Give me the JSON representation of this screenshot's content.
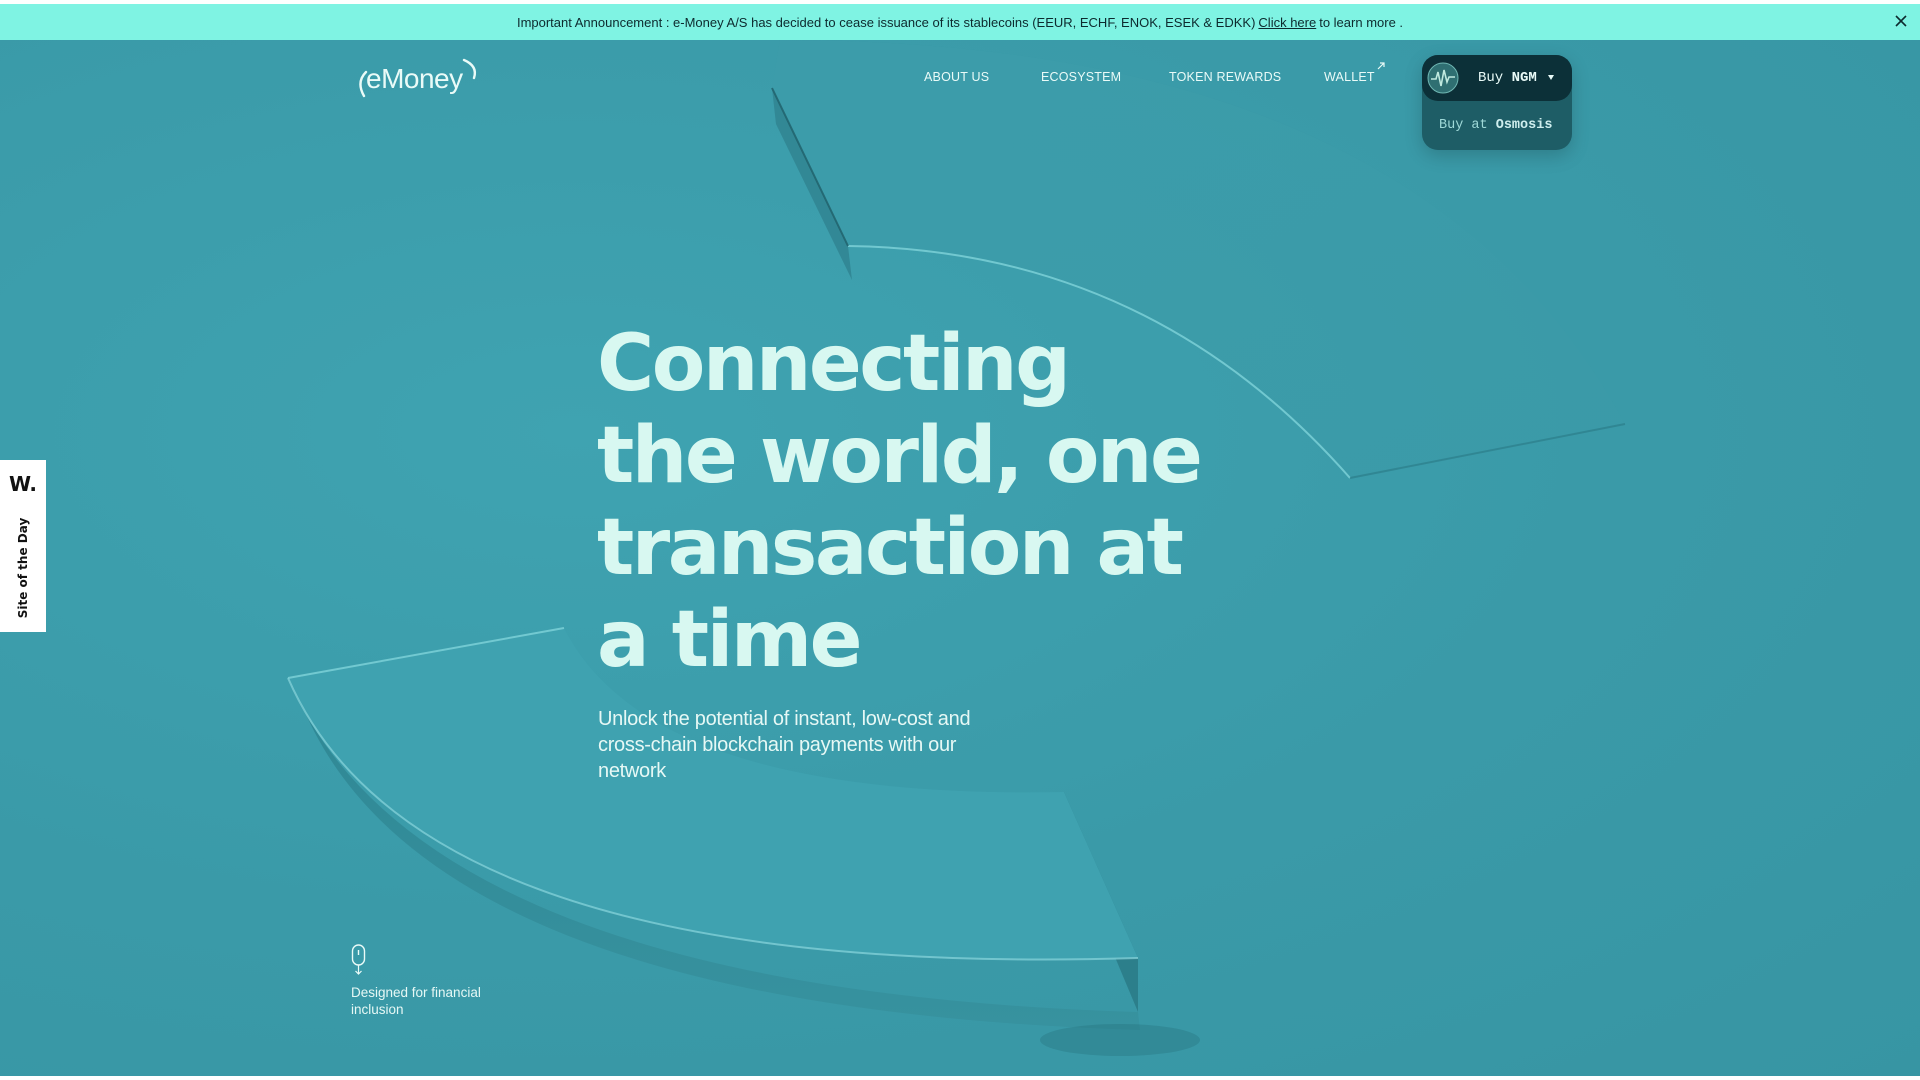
{
  "announcement": {
    "prefix": "Important Announcement : e-Money A/S has decided to cease issuance of its stablecoins (EEUR, ECHF, ENOK, ESEK & EDKK)",
    "link_label": "Click here",
    "suffix": "to learn more .",
    "close_icon": "close-icon"
  },
  "header": {
    "logo_text": "eMoney",
    "nav": [
      {
        "label": "ABOUT US"
      },
      {
        "label": "ECOSYSTEM"
      },
      {
        "label": "TOKEN REWARDS"
      },
      {
        "label": "WALLET",
        "icon": "external-link-icon"
      }
    ],
    "buy": {
      "label": "Buy",
      "token": "NGM",
      "option_prefix": "Buy at",
      "option_venue": "Osmosis"
    }
  },
  "hero": {
    "title": "Connecting the world, one transaction at a time",
    "subtitle": "Unlock the potential of instant, low-cost and cross-chain blockchain payments with our network"
  },
  "feature": {
    "icon": "scroll-mouse-icon",
    "text": "Designed for financial inclusion"
  },
  "award": {
    "logo": "W.",
    "label": "Site of the Day"
  },
  "colors": {
    "background": "#3a9aa8",
    "announcement_bar": "#7ff3e3",
    "heading": "#d8f8f1",
    "buy_button": "#0c3038"
  }
}
